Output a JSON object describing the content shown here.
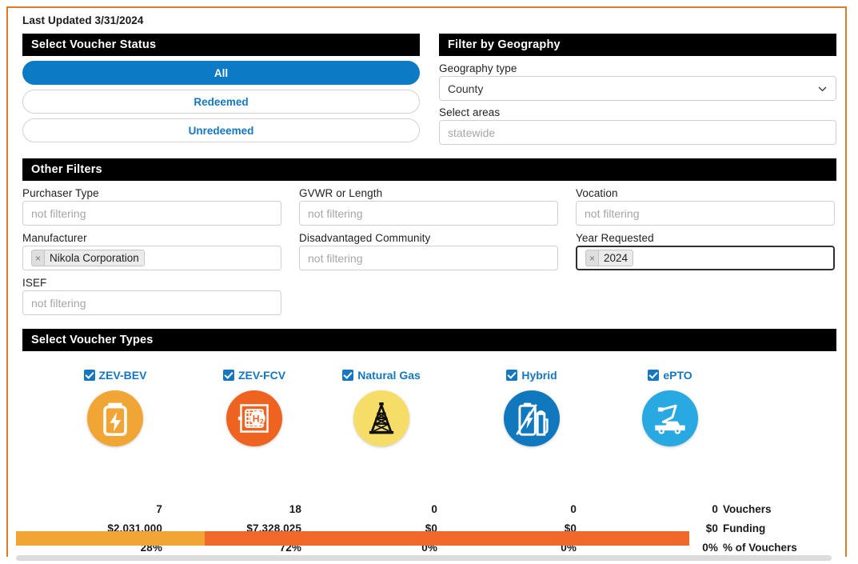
{
  "page": {
    "last_updated": "Last Updated 3/31/2024",
    "frame_color": "#e07b2a"
  },
  "voucher_status": {
    "title": "Select Voucher Status",
    "options": [
      {
        "label": "All",
        "selected": true
      },
      {
        "label": "Redeemed",
        "selected": false
      },
      {
        "label": "Unredeemed",
        "selected": false
      }
    ],
    "active_color": "#0c7ac4"
  },
  "geography": {
    "title": "Filter by Geography",
    "type_label": "Geography type",
    "type_value": "County",
    "areas_label": "Select areas",
    "areas_placeholder": "statewide",
    "chevron_icon": "chevron-down-icon"
  },
  "other_filters": {
    "title": "Other Filters",
    "fields": [
      {
        "label": "Purchaser Type",
        "placeholder": "not filtering",
        "value": "",
        "focused": false
      },
      {
        "label": "GVWR or Length",
        "placeholder": "not filtering",
        "value": "",
        "focused": false
      },
      {
        "label": "Vocation",
        "placeholder": "not filtering",
        "value": "",
        "focused": false
      },
      {
        "label": "Manufacturer",
        "placeholder": "",
        "value": "Nikola Corporation",
        "focused": false
      },
      {
        "label": "Disadvantaged Community",
        "placeholder": "not filtering",
        "value": "",
        "focused": false
      },
      {
        "label": "Year Requested",
        "placeholder": "",
        "value": "2024",
        "focused": true
      },
      {
        "label": "ISEF",
        "placeholder": "not filtering",
        "value": "",
        "focused": false
      }
    ],
    "token_remove_icon": "close-icon"
  },
  "voucher_types": {
    "title": "Select Voucher Types",
    "items": [
      {
        "label": "ZEV-BEV",
        "checked": true,
        "icon": "battery-bolt-icon",
        "circle_color": "#f0a535",
        "glyph_color": "#ffffff"
      },
      {
        "label": "ZEV-FCV",
        "checked": true,
        "icon": "hydrogen-fuelcell-icon",
        "circle_color": "#ef6321",
        "glyph_color": "#ffffff"
      },
      {
        "label": "Natural Gas",
        "checked": true,
        "icon": "gas-derrick-icon",
        "circle_color": "#f6dd68",
        "glyph_color": "#111111"
      },
      {
        "label": "Hybrid",
        "checked": true,
        "icon": "battery-fuelpump-icon",
        "circle_color": "#1278be",
        "glyph_color": "#ffffff"
      },
      {
        "label": "ePTO",
        "checked": true,
        "icon": "bucket-truck-icon",
        "circle_color": "#29a9e2",
        "glyph_color": "#ffffff"
      }
    ],
    "checkbox_color": "#1477bf"
  },
  "chart_data": {
    "type": "bar",
    "title": "Select Voucher Types",
    "categories": [
      "ZEV-BEV",
      "ZEV-FCV",
      "Natural Gas",
      "Hybrid",
      "ePTO"
    ],
    "row_labels": [
      "Vouchers",
      "Funding",
      "% of Vouchers"
    ],
    "series": [
      {
        "name": "Vouchers",
        "values": [
          "7",
          "18",
          "0",
          "0",
          "0"
        ]
      },
      {
        "name": "Funding",
        "values": [
          "$2.031.000",
          "$7.328.025",
          "$0",
          "$0",
          "$0"
        ]
      },
      {
        "name": "% of Vouchers",
        "values": [
          "28%",
          "72%",
          "0%",
          "0%",
          "0%"
        ]
      }
    ],
    "stacked_bar": {
      "segments": [
        {
          "name": "ZEV-BEV",
          "percent": 28,
          "color": "#f0a535"
        },
        {
          "name": "ZEV-FCV",
          "percent": 72,
          "color": "#f1692a"
        },
        {
          "name": "Natural Gas",
          "percent": 0,
          "color": "#f6dd68"
        },
        {
          "name": "Hybrid",
          "percent": 0,
          "color": "#1278be"
        },
        {
          "name": "ePTO",
          "percent": 0,
          "color": "#29a9e2"
        }
      ]
    }
  }
}
